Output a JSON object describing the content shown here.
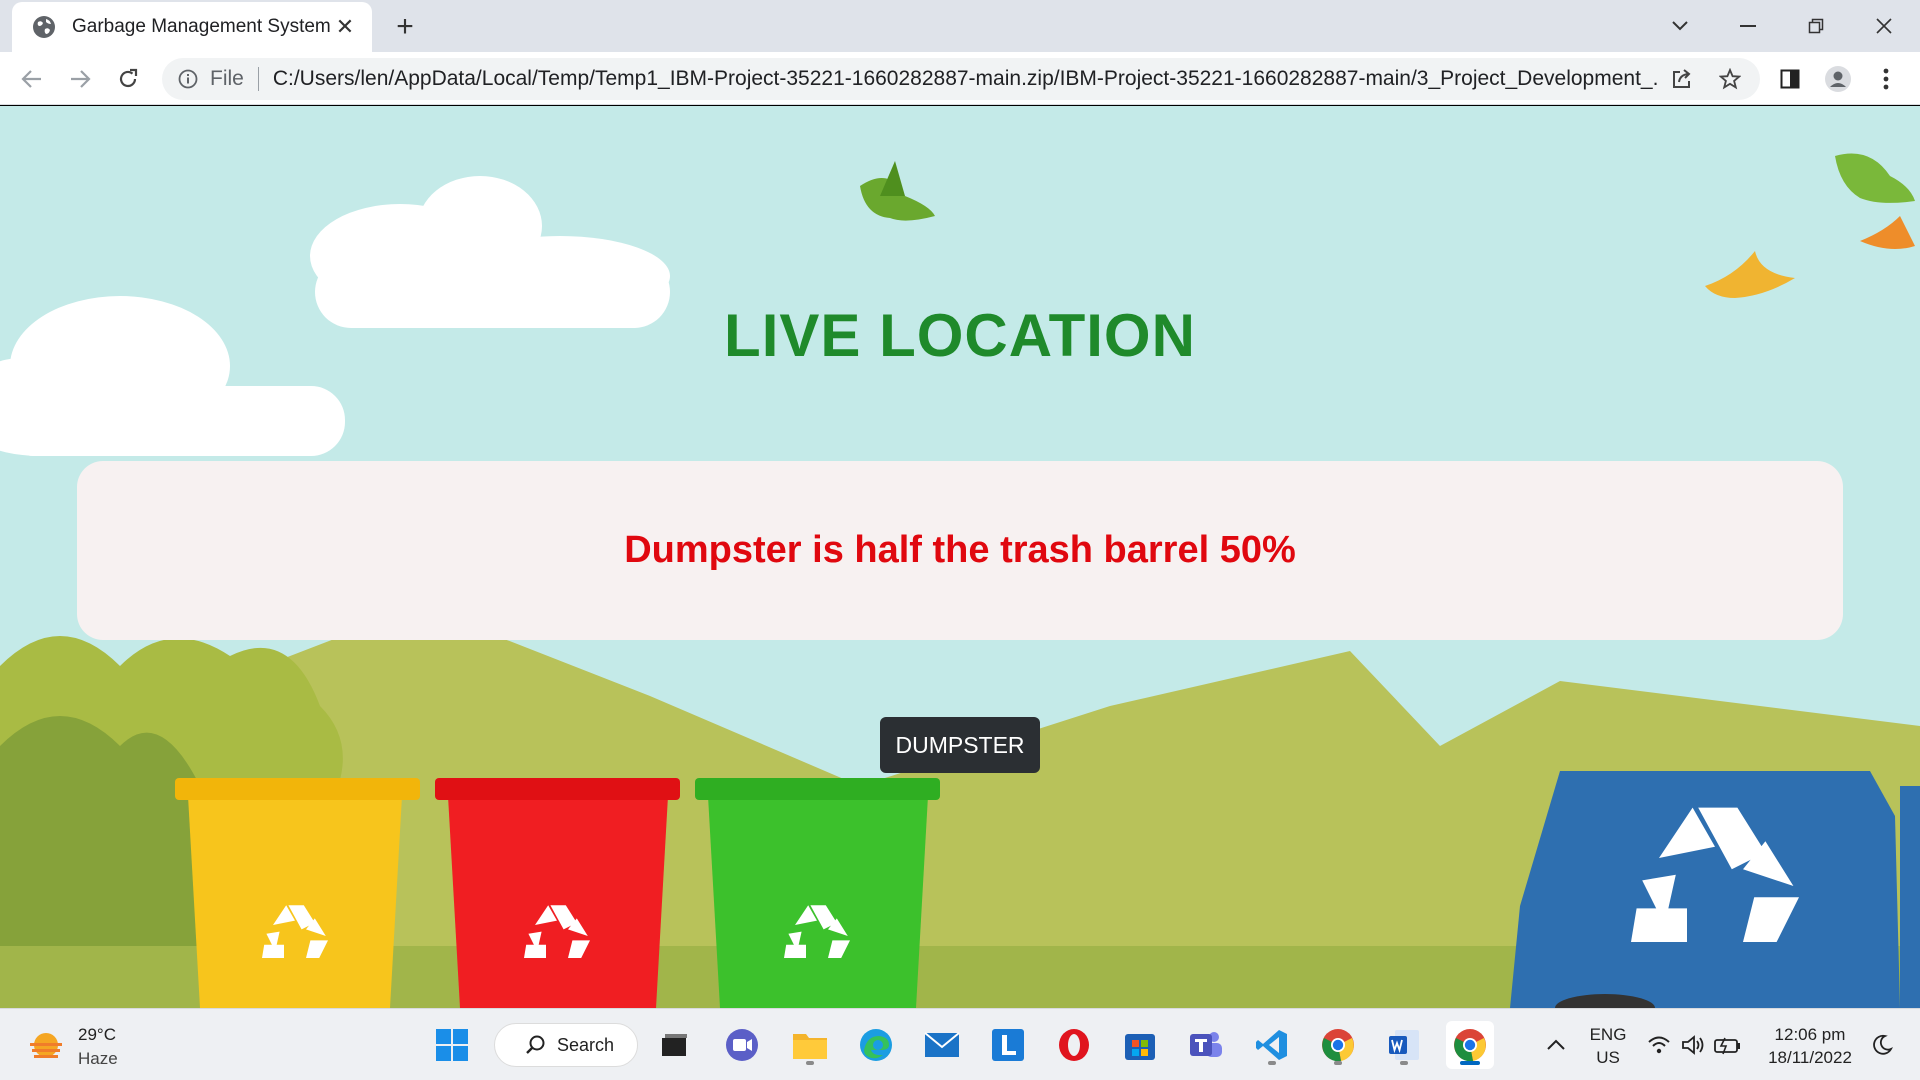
{
  "browser": {
    "tab_title": "Garbage Management System",
    "scheme_label": "File",
    "url": "C:/Users/len/AppData/Local/Temp/Temp1_IBM-Project-35221-1660282887-main.zip/IBM-Project-35221-1660282887-main/3_Project_Development_..."
  },
  "page": {
    "heading": "LIVE LOCATION",
    "status_message": "Dumpster is half the trash barrel 50%",
    "button_label": "DUMPSTER",
    "fill_level_percent": 50,
    "colors": {
      "heading": "#1f8a2b",
      "message": "#e0080f",
      "sky": "#c4eae8",
      "button": "#2b2f33"
    }
  },
  "taskbar": {
    "weather_temp": "29°C",
    "weather_desc": "Haze",
    "search_label": "Search",
    "lang_line1": "ENG",
    "lang_line2": "US",
    "time": "12:06 pm",
    "date": "18/11/2022",
    "apps": [
      "start",
      "search",
      "task-view",
      "teams-meet",
      "file-explorer",
      "edge",
      "mail",
      "l-app",
      "opera",
      "store",
      "teams",
      "vscode",
      "chrome",
      "word",
      "chrome-active"
    ]
  }
}
